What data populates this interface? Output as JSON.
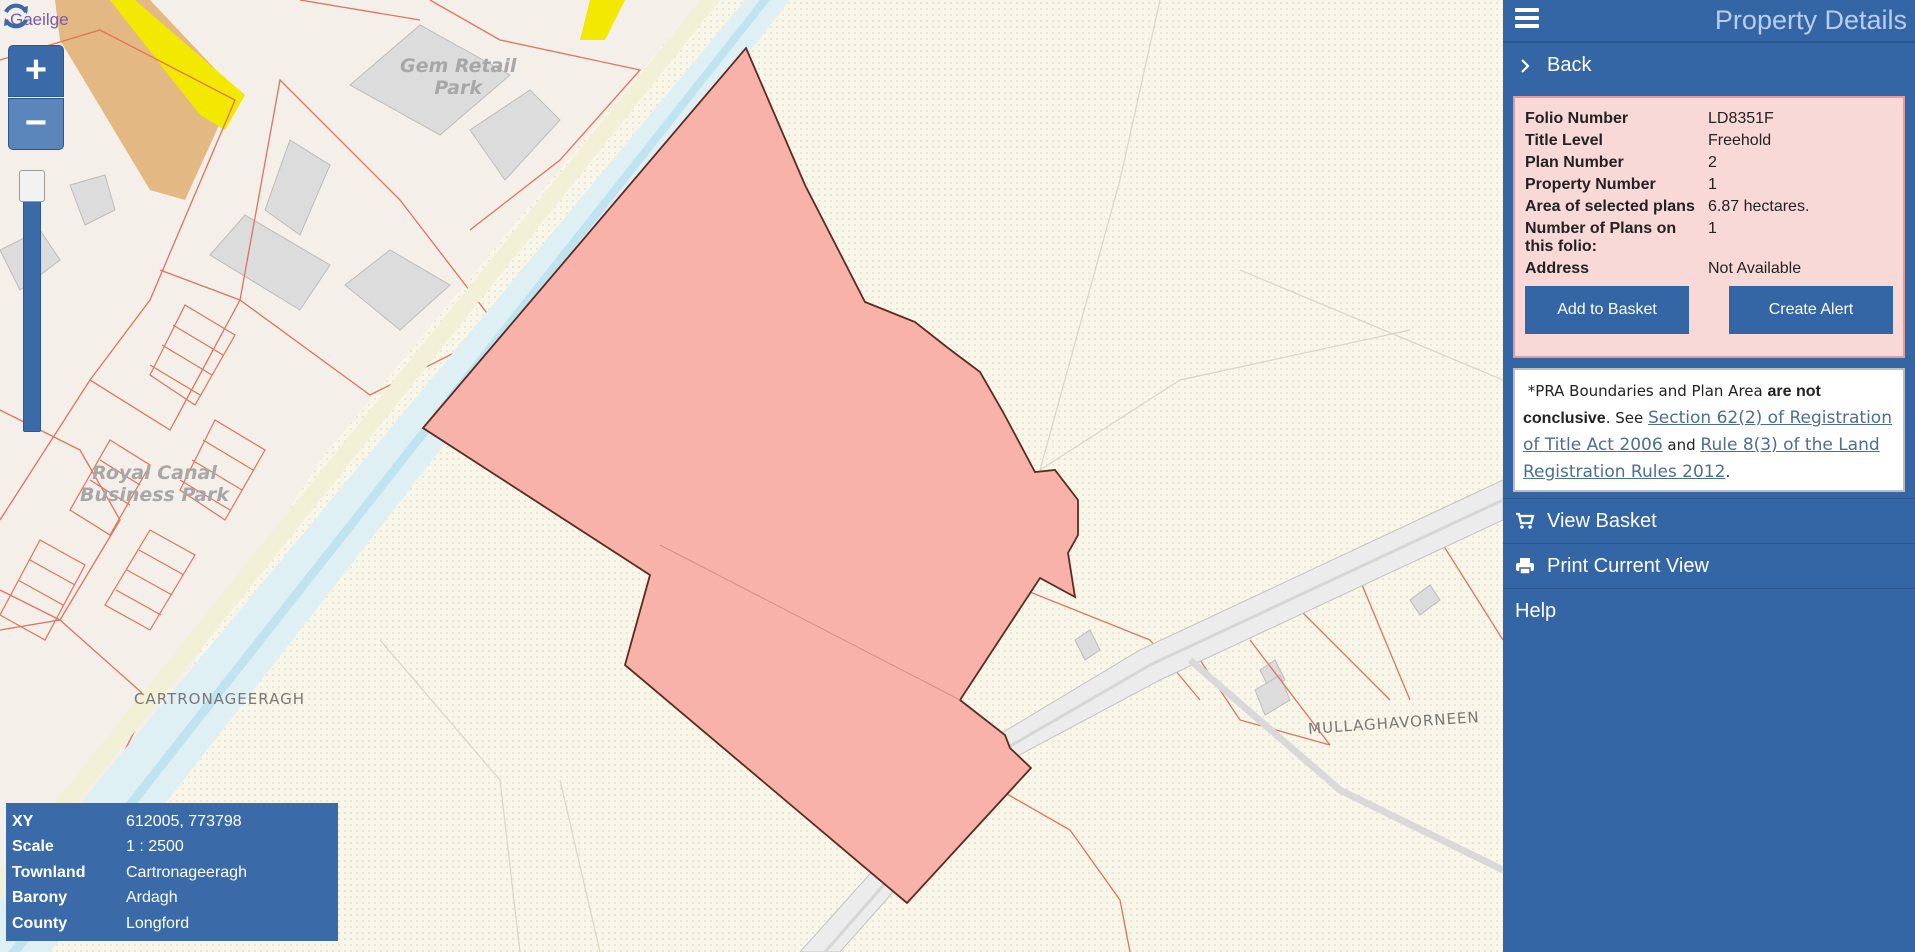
{
  "map": {
    "lang_link": "Gaeilge",
    "labels": {
      "gem_retail": "Gem Retail\nPark",
      "royal_canal": "Royal Canal\nBusiness Park",
      "cartronageeragh": "CARTRONAGEERAGH",
      "mullaghavorneen": "MULLAGHAVORNEEN"
    },
    "zoom": {
      "in_label": "+",
      "out_label": "−"
    },
    "parcel_color": "#f9b2aa",
    "info": [
      {
        "key": "XY",
        "value": "612005, 773798"
      },
      {
        "key": "Scale",
        "value": "1 : 2500"
      },
      {
        "key": "Townland",
        "value": "Cartronageeragh"
      },
      {
        "key": "Barony",
        "value": "Ardagh"
      },
      {
        "key": "County",
        "value": "Longford"
      }
    ]
  },
  "panel": {
    "title": "Property Details",
    "back": "Back",
    "details": [
      {
        "key": "Folio Number",
        "value": "LD8351F"
      },
      {
        "key": "Title Level",
        "value": "Freehold"
      },
      {
        "key": "Plan Number",
        "value": "2"
      },
      {
        "key": "Property Number",
        "value": "1"
      },
      {
        "key": "Area of selected plans",
        "value": "6.87 hectares."
      },
      {
        "key": "Number of Plans on this folio:",
        "value": "1"
      },
      {
        "key": "Address",
        "value": "Not Available"
      }
    ],
    "add_to_basket": "Add to Basket",
    "create_alert": "Create Alert",
    "disclaimer": {
      "p1": "*PRA Boundaries and Plan Area ",
      "bold": "are not conclusive",
      "p2": ". See ",
      "link1": "Section 62(2) of Registration of Title Act 2006",
      "p3": " and ",
      "link2": "Rule 8(3) of the Land Registration Rules 2012",
      "p4": "."
    },
    "view_basket": "View Basket",
    "print_view": "Print Current View",
    "help": "Help"
  }
}
